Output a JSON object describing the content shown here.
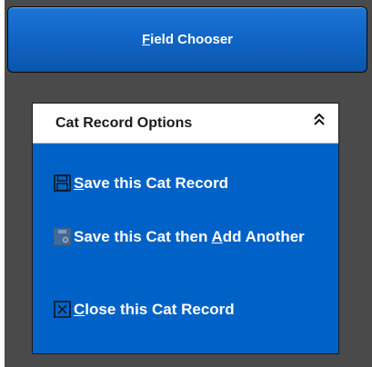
{
  "field_chooser": {
    "label_mnemonic": "F",
    "label_rest": "ield Chooser"
  },
  "options": {
    "title": "Cat Record Options",
    "collapse_icon": "double-chevron-up-icon",
    "items": [
      {
        "icon": "floppy-disk-icon",
        "mnemonic": "S",
        "label_rest": "ave this Cat Record"
      },
      {
        "icon": "floppy-disk-gear-icon",
        "label_before": "Save this Cat then ",
        "mnemonic": "A",
        "label_after": "dd Another"
      },
      {
        "icon": "close-box-icon",
        "mnemonic": "C",
        "label_rest": "lose this Cat Record"
      }
    ]
  },
  "colors": {
    "panel_blue": "#0062c7",
    "button_blue": "#1166c7",
    "background_gray": "#4a4a4a"
  }
}
